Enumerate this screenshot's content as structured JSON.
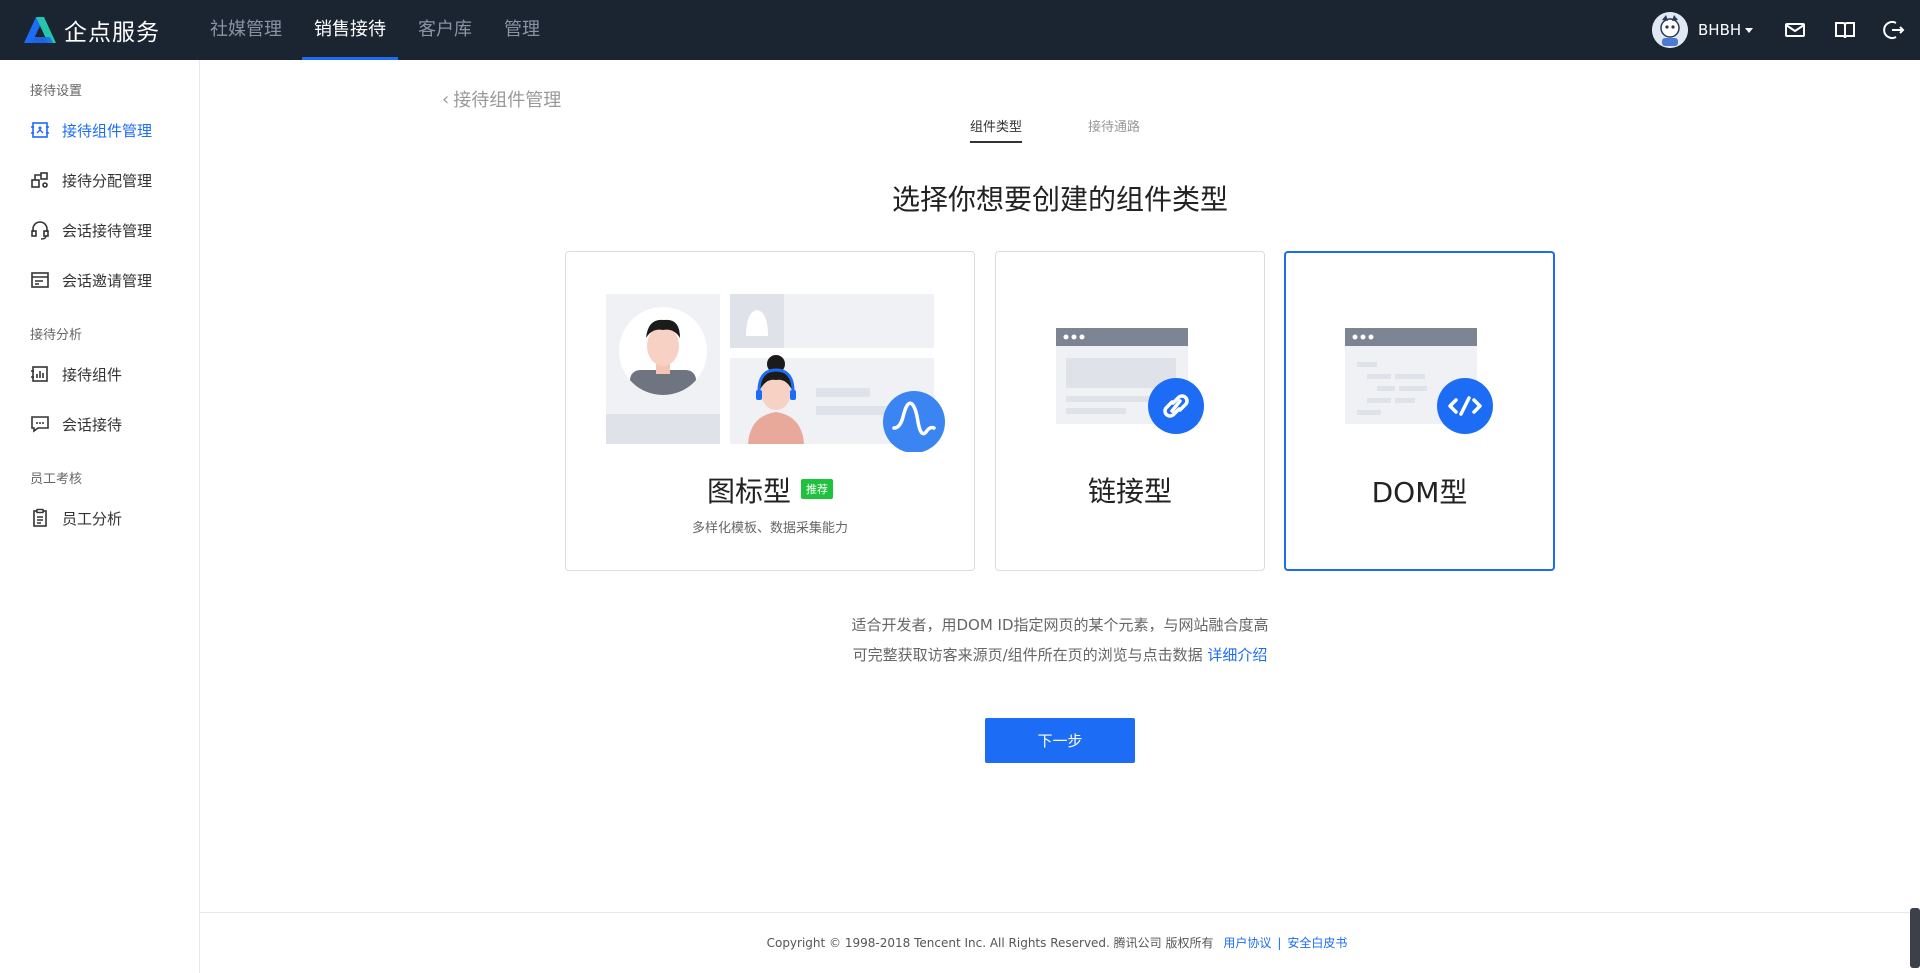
{
  "brand": {
    "name": "企点服务",
    "accent": "#1d6cf5",
    "topbar_bg": "#1b2431"
  },
  "nav": {
    "items": [
      {
        "label": "社媒管理",
        "active": false
      },
      {
        "label": "销售接待",
        "active": true
      },
      {
        "label": "客户库",
        "active": false
      },
      {
        "label": "管理",
        "active": false
      }
    ]
  },
  "user": {
    "name": "BHBH"
  },
  "top_icons": [
    "mail-icon",
    "book-icon",
    "logout-icon"
  ],
  "sidebar": {
    "groups": [
      {
        "title": "接待设置",
        "items": [
          {
            "label": "接待组件管理",
            "icon": "widget-icon",
            "active": true
          },
          {
            "label": "接待分配管理",
            "icon": "assign-icon",
            "active": false
          },
          {
            "label": "会话接待管理",
            "icon": "headset-icon",
            "active": false
          },
          {
            "label": "会话邀请管理",
            "icon": "invite-icon",
            "active": false
          }
        ]
      },
      {
        "title": "接待分析",
        "items": [
          {
            "label": "接待组件",
            "icon": "chart-icon",
            "active": false
          },
          {
            "label": "会话接待",
            "icon": "chat-icon",
            "active": false
          }
        ]
      },
      {
        "title": "员工考核",
        "items": [
          {
            "label": "员工分析",
            "icon": "clipboard-icon",
            "active": false
          }
        ]
      }
    ]
  },
  "main": {
    "back_label": "接待组件管理",
    "tabs": [
      {
        "label": "组件类型",
        "active": true
      },
      {
        "label": "接待通路",
        "active": false
      }
    ],
    "heading": "选择你想要创建的组件类型",
    "cards": [
      {
        "title": "图标型",
        "tag": "推荐",
        "subtitle": "多样化模板、数据采集能力",
        "selected": false
      },
      {
        "title": "链接型",
        "tag": "",
        "subtitle": "",
        "selected": false
      },
      {
        "title": "DOM型",
        "tag": "",
        "subtitle": "",
        "selected": true
      }
    ],
    "desc_line1": "适合开发者，用DOM ID指定网页的某个元素，与网站融合度高",
    "desc_line2": "可完整获取访客来源页/组件所在页的浏览与点击数据",
    "desc_link": "详细介绍",
    "next_button": "下一步"
  },
  "footer": {
    "copyright": "Copyright © 1998-2018 Tencent Inc. All Rights Reserved. 腾讯公司 版权所有",
    "link1": "用户协议",
    "separator": "|",
    "link2": "安全白皮书"
  }
}
